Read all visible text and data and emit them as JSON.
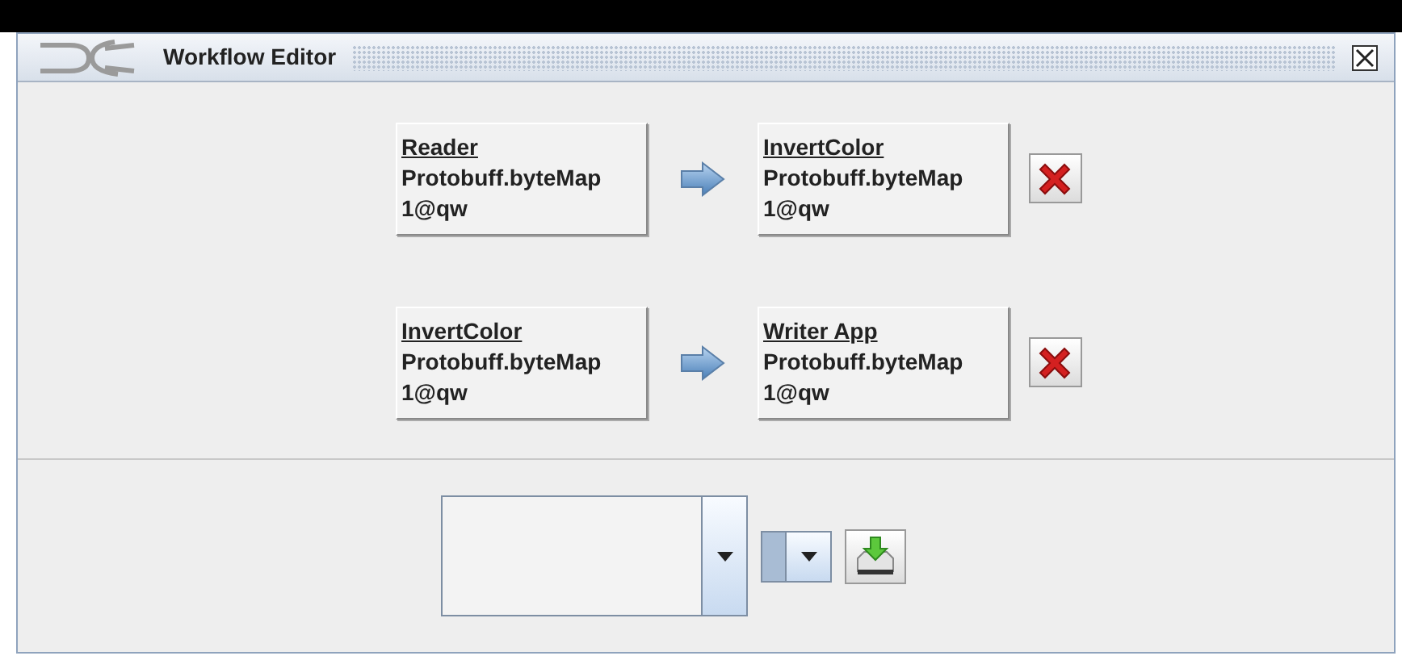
{
  "window": {
    "title": "Workflow Editor"
  },
  "connections": [
    {
      "source": {
        "name": "Reader",
        "type": "Protobuff.byteMap",
        "location": "1@qw"
      },
      "target": {
        "name": "InvertColor",
        "type": "Protobuff.byteMap",
        "location": "1@qw"
      }
    },
    {
      "source": {
        "name": "InvertColor",
        "type": "Protobuff.byteMap",
        "location": "1@qw"
      },
      "target": {
        "name": "Writer App",
        "type": "Protobuff.byteMap",
        "location": "1@qw"
      }
    }
  ]
}
